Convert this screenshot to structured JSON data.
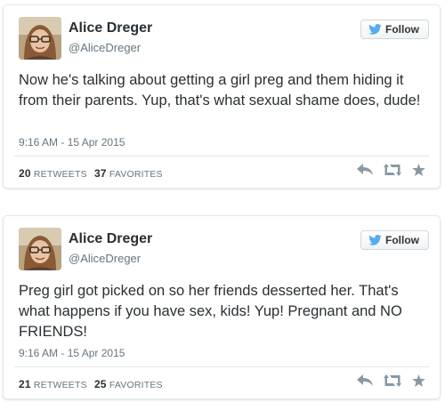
{
  "tweets": [
    {
      "name": "Alice Dreger",
      "handle": "@AliceDreger",
      "follow_label": "Follow",
      "text": "Now he's talking about getting a girl preg and them hiding it from their parents. Yup, that's what sexual shame does, dude!",
      "timestamp": "9:16 AM - 15 Apr 2015",
      "retweets_count": "20",
      "retweets_label": "RETWEETS",
      "favorites_count": "37",
      "favorites_label": "FAVORITES"
    },
    {
      "name": "Alice Dreger",
      "handle": "@AliceDreger",
      "follow_label": "Follow",
      "text": "Preg girl got picked on so her friends desserted her. That's what happens if you have sex, kids! Yup! Pregnant and NO FRIENDS!",
      "timestamp": "9:16 AM - 15 Apr 2015",
      "retweets_count": "21",
      "retweets_label": "RETWEETS",
      "favorites_count": "25",
      "favorites_label": "FAVORITES"
    }
  ],
  "colors": {
    "twitter_blue": "#55acee",
    "action_gray": "#8899a6",
    "text": "#292f33",
    "muted": "#66757f"
  },
  "icons": [
    "twitter-bird-icon",
    "reply-icon",
    "retweet-icon",
    "favorite-star-icon"
  ]
}
